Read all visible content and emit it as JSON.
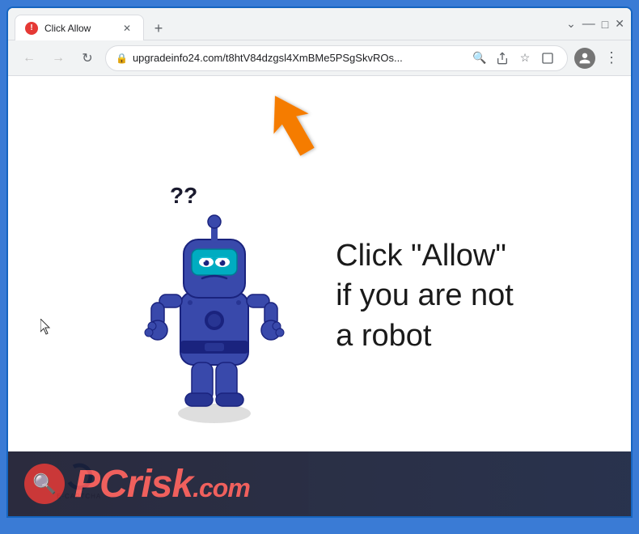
{
  "browser": {
    "tab": {
      "title": "Click Allow",
      "favicon": "warning-icon"
    },
    "new_tab_label": "+",
    "window_controls": {
      "minimize": "—",
      "maximize": "□",
      "close": "✕"
    },
    "nav": {
      "back": "←",
      "forward": "→",
      "refresh": "↻"
    },
    "address_bar": {
      "url": "upgradeinfo24.com/t8htV84dzgsl4XmBMe5PSgSkvROs...",
      "lock_icon": "🔒"
    },
    "toolbar_icons": {
      "search": "🔍",
      "share": "↗",
      "bookmark": "☆",
      "extension": "□",
      "menu": "⋮"
    }
  },
  "page": {
    "captcha_text_line1": "Click \"Allow\"",
    "captcha_text_line2": "if you are not",
    "captcha_text_line3": "a robot",
    "ecaptcha_label": "E-CAPTCHA"
  },
  "watermark": {
    "brand_pc": "PC",
    "brand_risk": "risk",
    "brand_domain": ".com"
  },
  "colors": {
    "robot_body": "#3949ab",
    "robot_dark": "#1a237e",
    "robot_visor": "#26c6da",
    "orange_arrow": "#f57c00",
    "browser_border": "#1565c0"
  }
}
